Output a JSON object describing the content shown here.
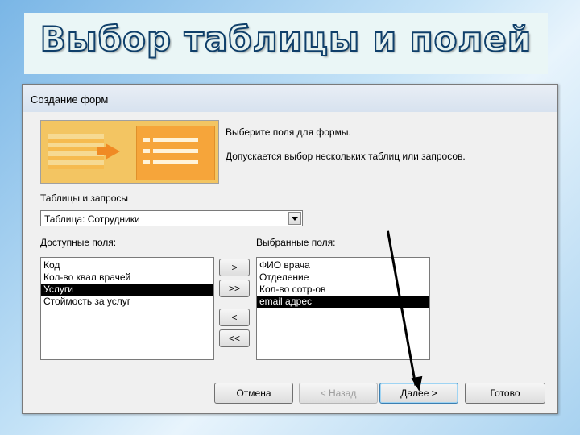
{
  "slide": {
    "title": "Выбор таблицы и полей"
  },
  "dialog": {
    "title": "Создание форм",
    "intro_line1": "Выберите поля для формы.",
    "intro_line2": "Допускается выбор нескольких таблиц или запросов.",
    "tables_label": "Таблицы и запросы",
    "table_select_value": "Таблица: Сотрудники",
    "available_label": "Доступные поля:",
    "selected_label": "Выбранные поля:",
    "available_fields": [
      {
        "label": "Код",
        "selected": false
      },
      {
        "label": "Кол-во квал врачей",
        "selected": false
      },
      {
        "label": "Услуги",
        "selected": true
      },
      {
        "label": "Стоймость за услуг",
        "selected": false
      }
    ],
    "selected_fields": [
      {
        "label": "ФИО врача",
        "selected": false
      },
      {
        "label": "Отделение",
        "selected": false
      },
      {
        "label": "Кол-во сотр-ов",
        "selected": false
      },
      {
        "label": "email адрес",
        "selected": true
      }
    ],
    "move_buttons": {
      "add_one": ">",
      "add_all": ">>",
      "remove_one": "<",
      "remove_all": "<<"
    },
    "footer": {
      "cancel": "Отмена",
      "back": "< Назад",
      "next": "Далее >",
      "finish": "Готово"
    }
  },
  "icons": {
    "dropdown": "chevron-down-icon",
    "illustration": "form-wizard-illustration"
  }
}
